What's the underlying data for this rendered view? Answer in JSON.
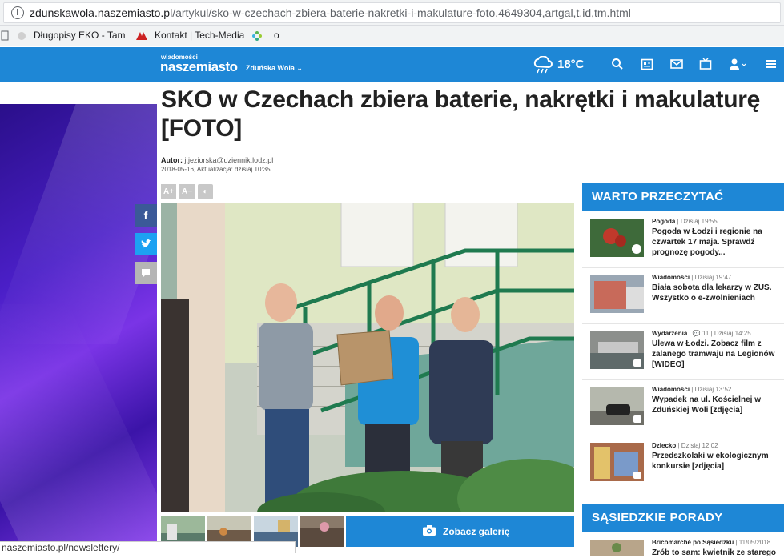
{
  "browser": {
    "url_domain": "zdunskawola.naszemiasto.pl",
    "url_path": "/artykul/sko-w-czechach-zbiera-baterie-nakretki-i-makulature-foto,4649304,artgal,t,id,tm.html",
    "bookmarks": [
      "Długopisy EKO - Tam",
      "Kontakt | Tech-Media",
      "o"
    ],
    "status_url": "naszemiasto.pl/newslettery/"
  },
  "header": {
    "logo_small": "wiadomości",
    "logo_main": "naszemiasto",
    "logo_city": "Zduńska Wola",
    "temperature": "18°C",
    "icons": [
      "search-icon",
      "calendar-icon",
      "mail-icon",
      "tv-icon",
      "user-icon",
      "menu-icon"
    ]
  },
  "article": {
    "title": "SKO w Czechach zbiera baterie, nakrętki i makulaturę [FOTO]",
    "author_label": "Autor:",
    "author": "j.jeziorska@dziennik.lodz.pl",
    "date": "2018-05-16, Aktualizacja: dzisiaj 10:35",
    "font_buttons": [
      "A+",
      "A−",
      "◐"
    ],
    "share": [
      "f",
      "t",
      "💬"
    ],
    "gallery_button": "Zobacz galerię"
  },
  "sidebar": {
    "heading1": "WARTO PRZECZYTAĆ",
    "heading2": "SĄSIEDZKIE PORADY",
    "items": [
      {
        "category": "Pogoda",
        "time": "Dzisiaj 19:55",
        "comments": "",
        "title": "Pogoda w Łodzi i regionie na czwartek 17 maja. Sprawdź prognozę pogody..."
      },
      {
        "category": "Wiadomości",
        "time": "Dzisiaj 19:47",
        "comments": "",
        "title": "Biała sobota dla lekarzy w ZUS. Wszystko o e-zwolnieniach"
      },
      {
        "category": "Wydarzenia",
        "time": "Dzisiaj 14:25",
        "comments": "11",
        "title": "Ulewa w Łodzi. Zobacz film z zalanego tramwaju na Legionów [WIDEO]"
      },
      {
        "category": "Wiadomości",
        "time": "Dzisiaj 13:52",
        "comments": "",
        "title": "Wypadek na ul. Kościelnej w Zduńskiej Woli [zdjęcia]"
      },
      {
        "category": "Dziecko",
        "time": "Dzisiaj 12:02",
        "comments": "",
        "title": "Przedszkolaki w ekologicznym konkursie [zdjęcia]"
      }
    ],
    "porady": {
      "category": "Bricomarché po Sąsiedzku",
      "time": "11/05/2018",
      "title": "Zrób to sam: kwietnik ze starego"
    }
  },
  "colors": {
    "brand": "#1e87d6",
    "ad": "#4b1fc8"
  }
}
